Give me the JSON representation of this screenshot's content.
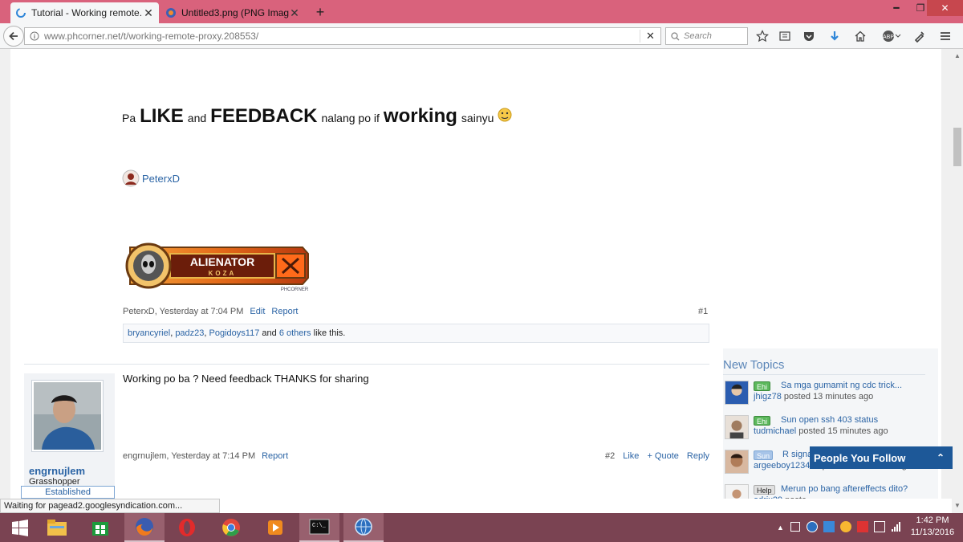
{
  "browser": {
    "tabs": [
      {
        "label": "Tutorial - Working remote..."
      },
      {
        "label": "Untitled3.png (PNG Image..."
      }
    ],
    "new_tab": "+",
    "url": {
      "domain": "www.phcorner.net",
      "path": "/t/working-remote-proxy.208553/"
    },
    "search_placeholder": "Search",
    "status_text": "Waiting for pagead2.googlesyndication.com..."
  },
  "post1": {
    "text_pa": "Pa",
    "text_like": "LIKE",
    "text_and": "and",
    "text_feedback": "FEEDBACK",
    "text_nalang": "nalang po if",
    "text_working": "working",
    "text_sainyu": "sainyu",
    "signature_user": "PeterxD",
    "banner_text": "ALIENATOR",
    "banner_sub": "KOZA",
    "banner_small": "PHCORNER",
    "meta": "PeterxD, Yesterday at 7:04 PM",
    "edit": "Edit",
    "report": "Report",
    "number": "#1",
    "likes": {
      "u1": "bryancyriel",
      "u2": "padz23",
      "u3": "Pogidoys117",
      "and": "and",
      "others": "6 others",
      "suffix": "like this."
    }
  },
  "post2": {
    "author": "engrnujlem",
    "rank": "Grasshopper",
    "badge": "Established",
    "text": "Working po ba ? Need feedback THANKS for sharing",
    "meta": "engrnujlem, Yesterday at 7:14 PM",
    "report": "Report",
    "number": "#2",
    "like": "Like",
    "quote": "+ Quote",
    "reply": "Reply"
  },
  "sidebar": {
    "title": "New Topics",
    "items": [
      {
        "badge": "Ehi",
        "title": "Sa mga gumamit ng cdc trick...",
        "user": "jhigz78",
        "posted": "posted 13 minutes ago",
        "badge_color": "#5cb85c"
      },
      {
        "badge": "Ehi",
        "title": "Sun open ssh 403 status",
        "user": "tudmichael",
        "posted": "posted 15 minutes ago",
        "badge_color": "#5cb85c"
      },
      {
        "badge": "Sun",
        "title": "R signal",
        "user": "argeeboy123444",
        "posted": "posted 27 minutes ago",
        "badge_color": "#a7c4e8"
      },
      {
        "badge": "Help",
        "title": "Merun po bang aftereffects dito?",
        "user": "odrix29",
        "posted": "poste",
        "badge_color": "#d6d6d6"
      }
    ],
    "people_follow": "People You Follow"
  },
  "taskbar": {
    "time": "1:42 PM",
    "date": "11/13/2016"
  }
}
